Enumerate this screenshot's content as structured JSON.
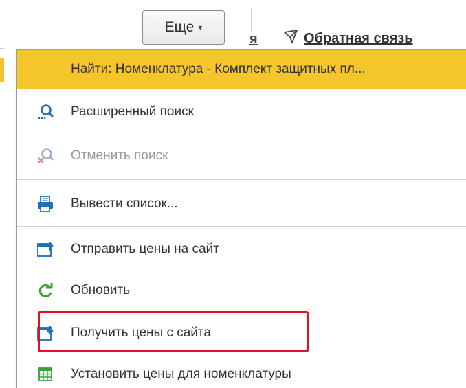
{
  "toolbar": {
    "more_label": "Еще",
    "more_caret": "▾",
    "partial_text": "я",
    "feedback_label": "Обратная связь"
  },
  "menu": {
    "items": [
      {
        "label": "Найти: Номенклатура - Комплект защитных пл...",
        "icon": null,
        "state": "highlighted"
      },
      {
        "label": "Расширенный поиск",
        "icon": "advanced-search-icon",
        "state": "enabled"
      },
      {
        "label": "Отменить поиск",
        "icon": "cancel-search-icon",
        "state": "disabled"
      },
      {
        "label": "Вывести список...",
        "icon": "print-list-icon",
        "state": "enabled"
      },
      {
        "label": "Отправить цены на сайт",
        "icon": "upload-window-icon",
        "state": "enabled"
      },
      {
        "label": "Обновить",
        "icon": "refresh-icon",
        "state": "enabled"
      },
      {
        "label": "Получить цены с сайта",
        "icon": "download-window-icon",
        "state": "enabled",
        "annotated": true
      },
      {
        "label": "Установить цены для номенклатуры",
        "icon": "table-icon",
        "state": "enabled"
      }
    ]
  },
  "colors": {
    "highlight": "#f5c52c",
    "annotation_border": "#e60f1e",
    "icon_blue": "#1f6fb8",
    "icon_green": "#3aa335"
  }
}
